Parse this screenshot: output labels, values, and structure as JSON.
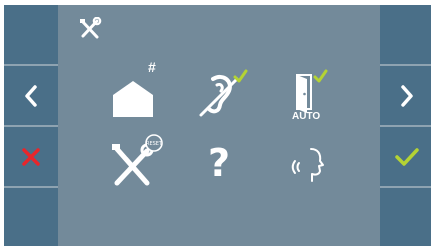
{
  "screen": {
    "header_icon": "tools-icon",
    "colors": {
      "background": "#738a9a",
      "side_panel": "#4a6f88",
      "cancel": "#e8262b",
      "confirm": "#b4d334",
      "icon": "#ffffff"
    }
  },
  "left_panel": {
    "items": [
      {
        "icon": "",
        "interactable": false
      },
      {
        "icon": "chevron-left-icon"
      },
      {
        "icon": "cancel-x-icon"
      },
      {
        "icon": ""
      }
    ]
  },
  "right_panel": {
    "items": [
      {
        "icon": ""
      },
      {
        "icon": "chevron-right-icon"
      },
      {
        "icon": "confirm-check-icon"
      },
      {
        "icon": ""
      }
    ]
  },
  "grid": {
    "items": [
      {
        "icon": "house-hash-icon",
        "badge": "#",
        "checked": false
      },
      {
        "icon": "hearing-loop-icon",
        "checked": true
      },
      {
        "icon": "auto-door-icon",
        "label": "AUTO",
        "checked": true
      },
      {
        "icon": "tools-reset-icon",
        "badge": "RESET",
        "checked": false
      },
      {
        "icon": "help-question-icon",
        "label": "?",
        "checked": false
      },
      {
        "icon": "voice-speech-icon",
        "checked": false
      }
    ]
  }
}
